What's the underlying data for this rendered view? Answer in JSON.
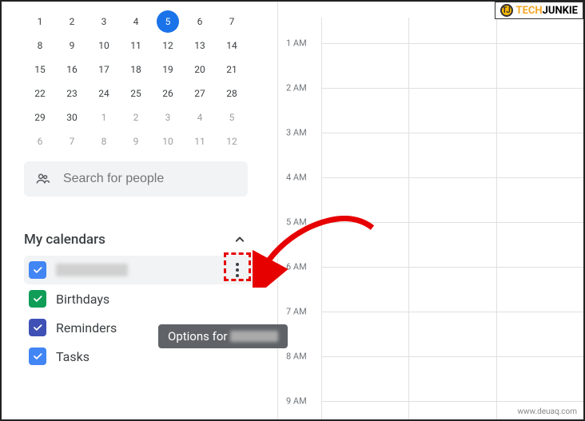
{
  "brand": {
    "name": "TECHJUNKIE"
  },
  "watermark": "www.deuaq.com",
  "mini_calendar": {
    "selected": 5,
    "rows": [
      [
        {
          "n": "1"
        },
        {
          "n": "2"
        },
        {
          "n": "3"
        },
        {
          "n": "4"
        },
        {
          "n": "5",
          "sel": true
        },
        {
          "n": "6"
        },
        {
          "n": "7"
        }
      ],
      [
        {
          "n": "8"
        },
        {
          "n": "9"
        },
        {
          "n": "10"
        },
        {
          "n": "11"
        },
        {
          "n": "12"
        },
        {
          "n": "13"
        },
        {
          "n": "14"
        }
      ],
      [
        {
          "n": "15"
        },
        {
          "n": "16"
        },
        {
          "n": "17"
        },
        {
          "n": "18"
        },
        {
          "n": "19"
        },
        {
          "n": "20"
        },
        {
          "n": "21"
        }
      ],
      [
        {
          "n": "22"
        },
        {
          "n": "23"
        },
        {
          "n": "24"
        },
        {
          "n": "25"
        },
        {
          "n": "26"
        },
        {
          "n": "27"
        },
        {
          "n": "28"
        }
      ],
      [
        {
          "n": "29"
        },
        {
          "n": "30"
        },
        {
          "n": "1",
          "m": true
        },
        {
          "n": "2",
          "m": true
        },
        {
          "n": "3",
          "m": true
        },
        {
          "n": "4",
          "m": true
        },
        {
          "n": "5",
          "m": true
        }
      ],
      [
        {
          "n": "6",
          "m": true
        },
        {
          "n": "7",
          "m": true
        },
        {
          "n": "8",
          "m": true
        },
        {
          "n": "9",
          "m": true
        },
        {
          "n": "10",
          "m": true
        },
        {
          "n": "11",
          "m": true
        },
        {
          "n": "12",
          "m": true
        }
      ]
    ]
  },
  "search": {
    "placeholder": "Search for people"
  },
  "section": {
    "title": "My calendars"
  },
  "calendars": [
    {
      "label": "",
      "redacted": true,
      "color": "#4285f4",
      "hovered": true
    },
    {
      "label": "Birthdays",
      "color": "#0f9d58"
    },
    {
      "label": "Reminders",
      "color": "#3f51b5"
    },
    {
      "label": "Tasks",
      "color": "#4285f4"
    }
  ],
  "tooltip": {
    "prefix": "Options for"
  },
  "time_labels": [
    "1 AM",
    "2 AM",
    "3 AM",
    "4 AM",
    "5 AM",
    "6 AM",
    "7 AM",
    "8 AM",
    "9 AM"
  ]
}
